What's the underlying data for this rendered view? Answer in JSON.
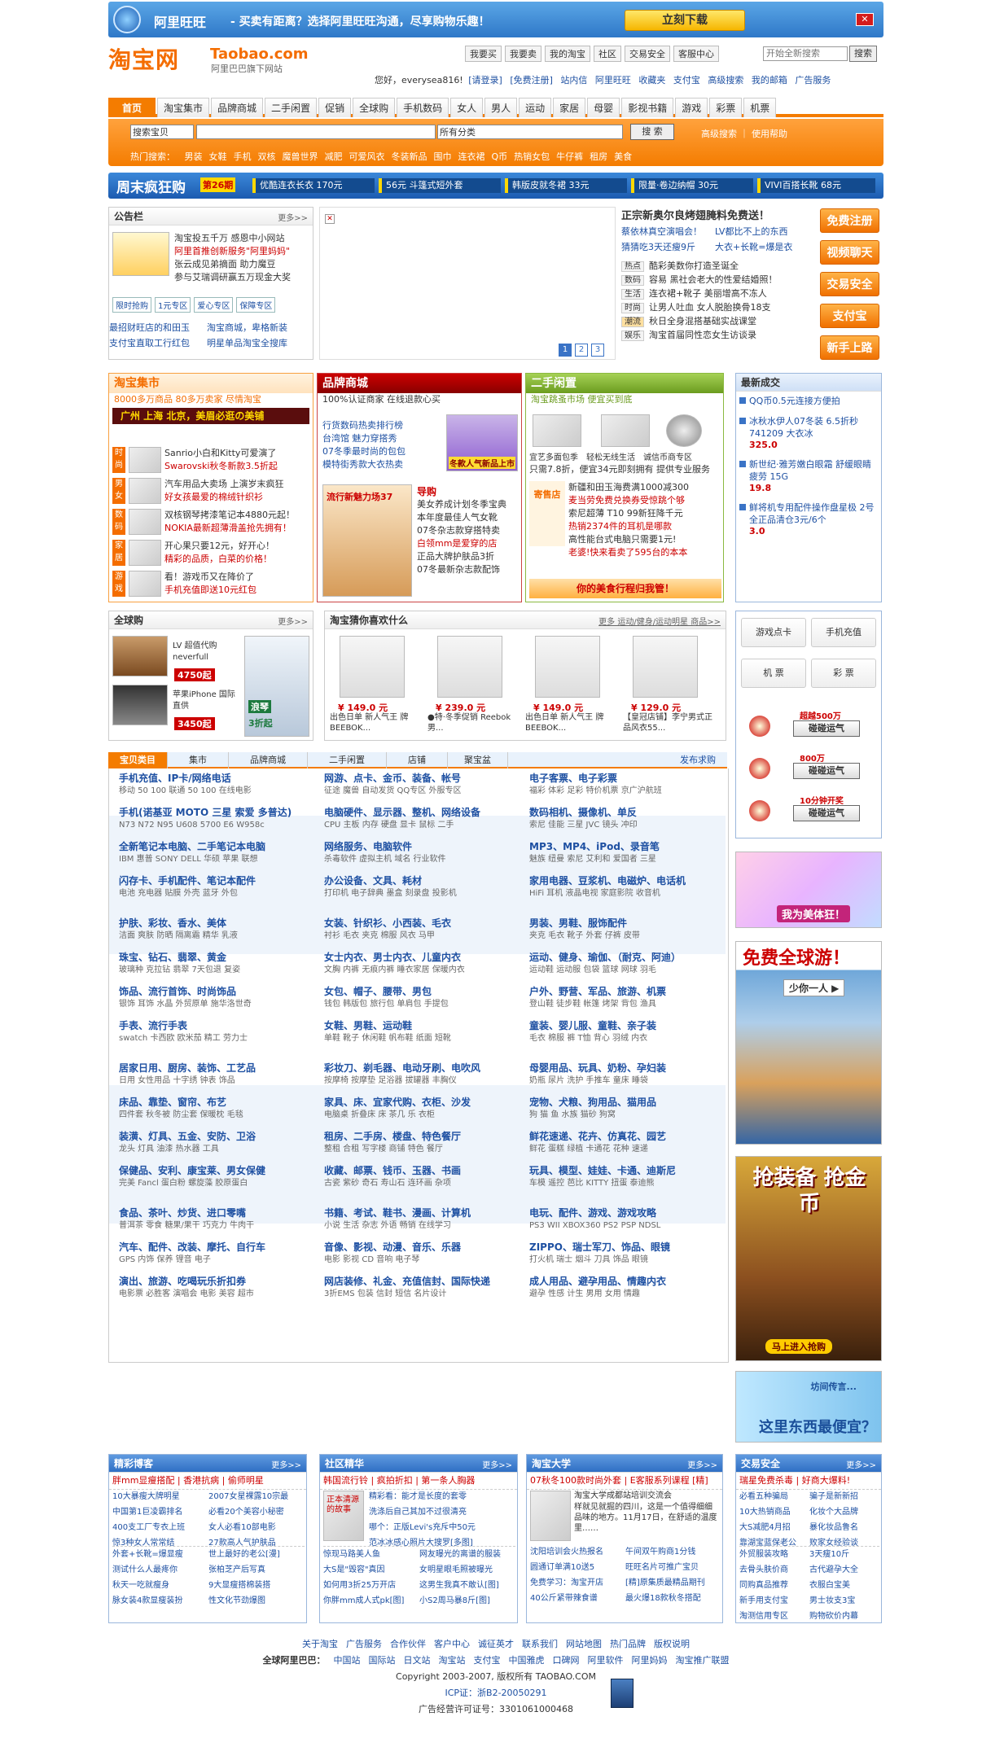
{
  "topbar": {
    "app": "阿里旺旺",
    "ad": " - 买卖有距离？选择阿里旺旺沟通，尽享购物乐趣！",
    "download": "立刻下载",
    "close": "✕"
  },
  "brand": {
    "cn": "淘宝网",
    "en": "Taobao.com",
    "sub": "阿里巴巴旗下网站"
  },
  "toplinks": [
    "我要买",
    "我要卖",
    "我的淘宝",
    "社区",
    "交易安全",
    "客服中心"
  ],
  "topsearch": {
    "placeholder": "开始全新搜索",
    "btn": "搜索"
  },
  "userline": {
    "hello": "您好，everysea816!",
    "items": [
      "[请登录]",
      "[免费注册]",
      "站内信",
      "阿里旺旺",
      "收藏夹",
      "支付宝",
      "高级搜索",
      "我的邮箱",
      "广告服务"
    ]
  },
  "nav": [
    "首页",
    "淘宝集市",
    "品牌商城",
    "二手闲置",
    "促销",
    "全球购",
    "手机数码",
    "女人",
    "男人",
    "运动",
    "家居",
    "母婴",
    "影视书籍",
    "游戏",
    "彩票",
    "机票"
  ],
  "search": {
    "scope": "搜索宝贝",
    "cat": "所有分类",
    "btn": "搜 索",
    "adv": "高级搜索 ｜ 使用帮助",
    "hot_label": "热门搜索：",
    "hot": [
      "男装",
      "女鞋",
      "手机",
      "双核",
      "魔兽世界",
      "减肥",
      "可爱风衣",
      "冬装新品",
      "围巾",
      "连衣裙",
      "Q币",
      "热销女包",
      "牛仔裤",
      "租房",
      "美食"
    ]
  },
  "promo": {
    "head": "周末疯狂购",
    "issue": "第26期",
    "items": [
      "优酷连衣长衣 170元",
      "56元 斗篷式短外套",
      "韩版皮就冬裙 33元",
      "限量·卷边纳帽 30元",
      "VIVI百搭长靴 68元"
    ]
  },
  "notice": {
    "title": "公告栏",
    "more": "更多>>",
    "lines": [
      "淘宝投五千万 感恩中小网站",
      "阿里首推创新服务\"阿里妈妈\"",
      "张云成见弟摘面 助力魔豆",
      "参与艾瑞调研赢五万现金大奖"
    ],
    "tags": [
      "限时抢购",
      "1元专区",
      "爱心专区",
      "保障专区"
    ],
    "links": [
      "最招财旺店的和田玉",
      "淘宝商城，卑格新装",
      "支付宝直取工行红包",
      "明星单品淘宝全搜库"
    ]
  },
  "center": {
    "headline": "正宗新奥尔良烤翅腌料免费送！",
    "sub": [
      "蔡依林真空演唱会！",
      "LV都比不上的东西",
      "猜猜吃3天还瘦9斤",
      "大衣+长靴=爆是衣"
    ],
    "rows": [
      [
        "热点",
        "酷彩美数你打造圣诞全"
      ],
      [
        "数码",
        "容易 黑社会老大的性爱结婚照！"
      ],
      [
        "生活",
        "连衣裙+靴子 美丽增高不冻人"
      ],
      [
        "时尚",
        "让男人吐血 女人脱胎换骨18支"
      ],
      [
        "潮流",
        "秋日全身混搭基础实战课堂"
      ],
      [
        "娱乐",
        "淘宝首届同性恋女生访谈录"
      ]
    ],
    "pages": [
      "1",
      "2",
      "3"
    ]
  },
  "side_btns": [
    "免费注册",
    "视频聊天",
    "交易安全",
    "支付宝",
    "新手上路"
  ],
  "jishi": {
    "title": "淘宝集市",
    "sub": "8000多万商品 80多万卖家 尽情淘宝",
    "banner": "广州 上海 北京，美眉必逛の美铺",
    "rows": [
      [
        "时尚",
        "Sanrio小白和Kitty可爱演了",
        "Swarovski秋冬新款3.5折起"
      ],
      [
        "男女",
        "汽车用品大卖场 上演岁末疯狂",
        "好女孩最爱的棉绒针织衫"
      ],
      [
        "数码",
        "双核钢琴拷漆笔记本4880元起！",
        "NOKIA最新超薄滑盖抢先拥有！"
      ],
      [
        "家居",
        "开心果只要12元，好开心！",
        "精彩的品质，白菜的价格！"
      ],
      [
        "游戏",
        "看！游戏币又在降价了",
        "手机充值即送10元红包"
      ]
    ]
  },
  "shangcheng": {
    "title": "品牌商城",
    "sub": "100%认证商家 在线退款心买",
    "lines": [
      "行货数码热卖排行榜",
      "台湾馆 魅力穿搭秀",
      "07冬季最时尚的包包",
      "模特街秀款大衣热卖"
    ],
    "badge": "冬款人气新品上市",
    "promo": "流行新魅力场37",
    "guide": "导购",
    "guides": [
      "美女养成计划冬季宝典",
      "本年度最佳人气女靴",
      "07冬杂志款穿搭特卖",
      "白领mm是爱穿的店",
      "正品大牌护肤品3折",
      "07冬最新杂志款配饰"
    ]
  },
  "xianzhi": {
    "title": "二手闲置",
    "sub": "淘宝跳蚤市场 便宜买到底",
    "cap": [
      "宜艺多面包季",
      "轻松无线生活",
      "诚信币商专区"
    ],
    "line": "只需7.8折，便宜34元即刻拥有 提供专业服务",
    "tag": "寄售店",
    "lines": [
      "新疆和田玉海费满1000减300",
      "麦当劳免费兑换券受惊跳个够",
      "索尼超薄 T10 99新狂降千元",
      "热销2374件的耳机是哪款",
      "高性能台式电脑只需要1元!",
      "老婆!快来看卖了595台的本本"
    ],
    "ad": "你的美食行程归我管！"
  },
  "latest": {
    "title": "最新成交",
    "items": [
      [
        "QQ币0.5元连接方便拍",
        ""
      ],
      [
        "冰秋水伊人07冬装 6.5折秒741209 大衣冰",
        "325.0"
      ],
      [
        "新世纪·雅芳嫩白眼霜 舒缓眼睛疲劳 15G",
        "19.8"
      ],
      [
        "鲜将机专用配件操作盘星极 2号全正品清仓3元/6个",
        "3.0"
      ]
    ]
  },
  "quanqiu": {
    "title": "全球购",
    "more": "更多>>",
    "items": [
      [
        "LV 超值代购 neverfull",
        "4750起"
      ],
      [
        "苹果iPhone 国际直供",
        "3450起"
      ]
    ],
    "watch": "浪琴",
    "discount": "3折起"
  },
  "guess": {
    "title": "淘宝猜你喜欢什么",
    "more": "更多 运动/健身/运动明星 商品>>",
    "items": [
      [
        "¥ 149.0 元",
        "出色日单 新人气王 牌BEEBOK..."
      ],
      [
        "¥ 239.0 元",
        "●特·冬季促销 Reebok 男..."
      ],
      [
        "¥ 149.0 元",
        "出色日单 新人气王 牌BEEBOK..."
      ],
      [
        "¥ 129.0 元",
        "【皇冠店铺】李宁男式正品风衣55..."
      ]
    ]
  },
  "services": {
    "items": [
      "游戏点卡",
      "手机充值",
      "机 票",
      "彩 票"
    ],
    "lotto": [
      [
        "超越500万",
        "碰碰运气"
      ],
      [
        "800万",
        "碰碰运气"
      ],
      [
        "10分钟开奖",
        "碰碰运气"
      ]
    ]
  },
  "cats": {
    "tabs": [
      "宝贝类目",
      "集市",
      "品牌商城",
      "二手闲置",
      "店铺",
      "聚宝盆"
    ],
    "publish": "发布求购",
    "grid": [
      [
        "手机充值、IP卡/网络电话",
        "移动 50 100 联通 50 100 在线电影"
      ],
      [
        "网游、点卡、金币、装备、帐号",
        "征途 魔兽 自动发货 QQ专区 外服专区"
      ],
      [
        "电子客票、电子彩票",
        "福彩 体彩 足彩 特价机票 京广沪航班"
      ],
      [
        "手机(诺基亚 MOTO 三星 索爱 多普达)",
        "N73 N72 N95 U608 5700 E6 W958c"
      ],
      [
        "电脑硬件、显示器、整机、网络设备",
        "CPU 主板 内存 硬盘 显卡 鼠标 二手"
      ],
      [
        "数码相机、摄像机、单反",
        "索尼 佳能 三星 JVC 镜头 冲印"
      ],
      [
        "全新笔记本电脑、二手笔记本电脑",
        "IBM 惠普 SONY DELL 华硕 苹果 联想"
      ],
      [
        "网络服务、电脑软件",
        "杀毒软件 虚拟主机 域名 行业软件"
      ],
      [
        "MP3、MP4、iPod、录音笔",
        "魅族 纽曼 索尼 艾利和 爱国者 三星"
      ],
      [
        "闪存卡、手机配件、笔记本配件",
        "电池 充电器 贴膜 外壳 蓝牙 外包"
      ],
      [
        "办公设备、文具、耗材",
        "打印机 电子辞典 墨盒 刻录盘 投影机"
      ],
      [
        "家用电器、豆浆机、电磁炉、电话机",
        "HiFi 耳机 液晶电视 家庭影院 收音机"
      ],
      [
        "护肤、彩妆、香水、美体",
        "洁面 爽肤 防晒 隔离霜 精华 乳液"
      ],
      [
        "女装、针织衫、小西装、毛衣",
        "衬衫 毛衣 夹克 棉服 风衣 马甲"
      ],
      [
        "男装、男鞋、服饰配件",
        "夹克 毛衣 靴子 外套 仔裤 皮带"
      ],
      [
        "珠宝、钻石、翡翠、黄金",
        "玻璃种 克拉钻 翡翠 7天包退 复姿"
      ],
      [
        "女士内衣、男士内衣、儿童内衣",
        "文胸 内裤 无痕内裤 睡衣家居 保暖内衣"
      ],
      [
        "运动、健身、瑜伽、（耐克、阿迪）",
        "运动鞋 运动服 包袋 篮球 网球 羽毛"
      ],
      [
        "饰品、流行首饰、时尚饰品",
        "银饰 耳饰 水晶 外贸原单 施华洛世奇"
      ],
      [
        "女包、帽子、腰带、男包",
        "钱包 韩版包 旅行包 单肩包 手提包"
      ],
      [
        "户外、野营、军品、旅游、机票",
        "登山鞋 徒步鞋 帐篷 烤架 背包 渔具"
      ],
      [
        "手表、流行手表",
        "swatch 卡西欧 欧米茄 精工 劳力士"
      ],
      [
        "女鞋、男鞋、运动鞋",
        "单鞋 靴子 休闲鞋 帆布鞋 纸面 短靴"
      ],
      [
        "童装、婴儿服、童鞋、亲子装",
        "毛衣 棉服 裤 T恤 背心 羽绒 内衣"
      ],
      [
        "居家日用、厨房、装饰、工艺品",
        "日用 女性用品 十字绣 钟表 饰品"
      ],
      [
        "彩妆刀、剃毛器、电动牙刷、电吹风",
        "按摩椅 按摩垫 足浴器 拔罐器 丰胸仪"
      ],
      [
        "母婴用品、玩具、奶粉、孕妇装",
        "奶瓶 尿片 洗护 手推车 童床 睡袋"
      ],
      [
        "床品、靠垫、窗帘、布艺",
        "四件套 秋冬被 防尘套 保暖枕 毛毯"
      ],
      [
        "家具、床、宜家代购、衣柜、沙发",
        "电脑桌 折叠床 床 茶几 乐 衣柜"
      ],
      [
        "宠物、犬粮、狗用品、猫用品",
        "狗 猫 鱼 水族 猫砂 狗窝"
      ],
      [
        "装潢、灯具、五金、安防、卫浴",
        "龙头 灯具 油漆 热水器 工具"
      ],
      [
        "租房、二手房、楼盘、特色餐厅",
        "整租 合租 写字楼 商铺 特色 餐厅"
      ],
      [
        "鲜花速递、花卉、仿真花、园艺",
        "鲜花 蛋糕 绿植 卡通花 花种 速递"
      ],
      [
        "保健品、安利、康宝莱、男女保健",
        "完美 Fancl 蛋白粉 螺旋藻 胶原蛋白"
      ],
      [
        "收藏、邮票、钱币、玉器、书画",
        "古瓷 紫砂 奇石 寿山石 连环画 杂项"
      ],
      [
        "玩具、模型、娃娃、卡通、迪斯尼",
        "车模 遥控 芭比 KITTY 扭蛋 泰迪熊"
      ],
      [
        "食品、茶叶、炒货、进口零嘴",
        "普洱茶 零食 糖果/果干 巧克力 牛肉干"
      ],
      [
        "书籍、考试、鞋书、漫画、计算机",
        "小说 生活 杂志 外语 畅销 在线学习"
      ],
      [
        "电玩、配件、游戏、游戏攻略",
        "PS3 WII XBOX360 PS2 PSP NDSL"
      ],
      [
        "汽车、配件、改装、摩托、自行车",
        "GPS 内饰 保养 锂音 电子"
      ],
      [
        "音像、影视、动漫、音乐、乐器",
        "电影 影视 CD 音响 电子琴"
      ],
      [
        "ZIPPO、瑞士军刀、饰品、眼镜",
        "打火机 瑞士 烟斗 刀具 饰品 眼镜"
      ],
      [
        "演出、旅游、吃喝玩乐折扣券",
        "电影票 必胜客 演唱会 电影 美容 超市"
      ],
      [
        "网店装修、礼金、充值信封、国际快递",
        "3折EMS 包装 信封 短信 名片设计"
      ],
      [
        "成人用品、避孕用品、情趣内衣",
        "避孕 性感 计生 男用 女用 情趣"
      ]
    ]
  },
  "ads": {
    "a1": "我为美体狂！",
    "a2": "免费全球游！",
    "a2b": "少你一人 ▶",
    "a3": "抢装备 抢金币",
    "a3b": "马上进入抢购",
    "a4": "这里东西最便宜？",
    "a4b": "坊间传言..."
  },
  "bottom": [
    {
      "title": "精彩博客",
      "more": "更多>>",
      "tags": "胖mm显瘦搭配 | 香港抗病 | 偷师明星",
      "lines": [
        "10大暴瘦大牌明星",
        "2007女星裸露10宗最",
        "中国第1巨凌霸排名",
        "必看20个美容小秘密",
        "400支工厂专衣上班",
        "女人必看10部电影",
        "惊3种女人常常结",
        "27款高人气护肤品"
      ],
      "lines2": [
        "外套+长靴=爆显瘦",
        "世上最好的老公[漫]",
        "测试什么人最疼你",
        "张柏芝产后写真",
        "秋天一吃就瘦身",
        "9大显瘦搭棉装搭",
        "脉女装4款显瘦装扮",
        "性文化节劲爆图"
      ]
    },
    {
      "title": "社区精华",
      "more": "更多>>",
      "tags": "韩国流行铃 | 疯拍折扣 | 第一条人胸器",
      "img": "正本清源的故事",
      "lines": [
        "精彩看：能才是长度的套零",
        "洗涤后自己其加不过很清亮",
        "哪个：正版Levi's充斥中50元",
        "范冰冰感心照片大搜罗[多图]"
      ],
      "lines2": [
        "惊现马路美人鱼",
        "网友曝光的离谱的服装",
        "大S是\"毁容\"真因",
        "女明星眼毛照被曝光",
        "如何用3折25万开店",
        "这男生我真不敢认[图]",
        "你胖mm成人式pk[图]",
        "小S2周马暴8斤[图]"
      ]
    },
    {
      "title": "淘宝大学",
      "more": "更多>>",
      "tags": "07秋冬100款时尚外套 | E客服系列课程 [精]",
      "img": "淘宝大学成都站培训交流会",
      "body": "样就见就掘的四川，这是一个值得细细品味的地方。11月17日，在舒适的温度里……",
      "lines": [
        "沈阳培训会火热报名",
        "午间双午购商1分钱",
        "圆通订单满10送5",
        "旺旺名片可推广宝贝",
        "免费学习：淘宝开店",
        "[精]原集质最精品期刊",
        "40公斤紧带辣食谱",
        "最火爆18款秋冬搭配"
      ]
    },
    {
      "title": "交易安全",
      "more": "更多>>",
      "tags": "瑞星免费杀毒 | 好商大爆料!",
      "lines": [
        "必看五种骗局",
        "骗子是新新招",
        "10大热销商品",
        "化妆个大品牌",
        "大S减肥4月招",
        "暴化妆品鲁名",
        "靠湖宝蓝保老公",
        "败家女经验谈"
      ],
      "lines2": [
        "外贸服装攻略",
        "3天瘦10斤",
        "去骨头肤价商",
        "古代避孕大全",
        "同购真品推荐",
        "衣服白宝美",
        "新手用支付宝",
        "男士妆支3宝",
        "淘测信用专区",
        "购物砍价内幕"
      ]
    }
  ],
  "footer": {
    "links": [
      "关于淘宝",
      "广告服务",
      "合作伙伴",
      "客户中心",
      "诚征英才",
      "联系我们",
      "网站地图",
      "热门品牌",
      "版权说明"
    ],
    "alibaba_label": "全球阿里巴巴：",
    "alibaba": [
      "中国站",
      "国际站",
      "日文站",
      "淘宝站",
      "支付宝",
      "中国雅虎",
      "口碑网",
      "阿里软件",
      "阿里妈妈",
      "淘宝推广联盟"
    ],
    "copyright": "Copyright 2003-2007, 版权所有 TAOBAO.COM",
    "icp": "ICP证：浙B2-20050291",
    "ad_license": "广告经营许可证号：3301061000468"
  }
}
